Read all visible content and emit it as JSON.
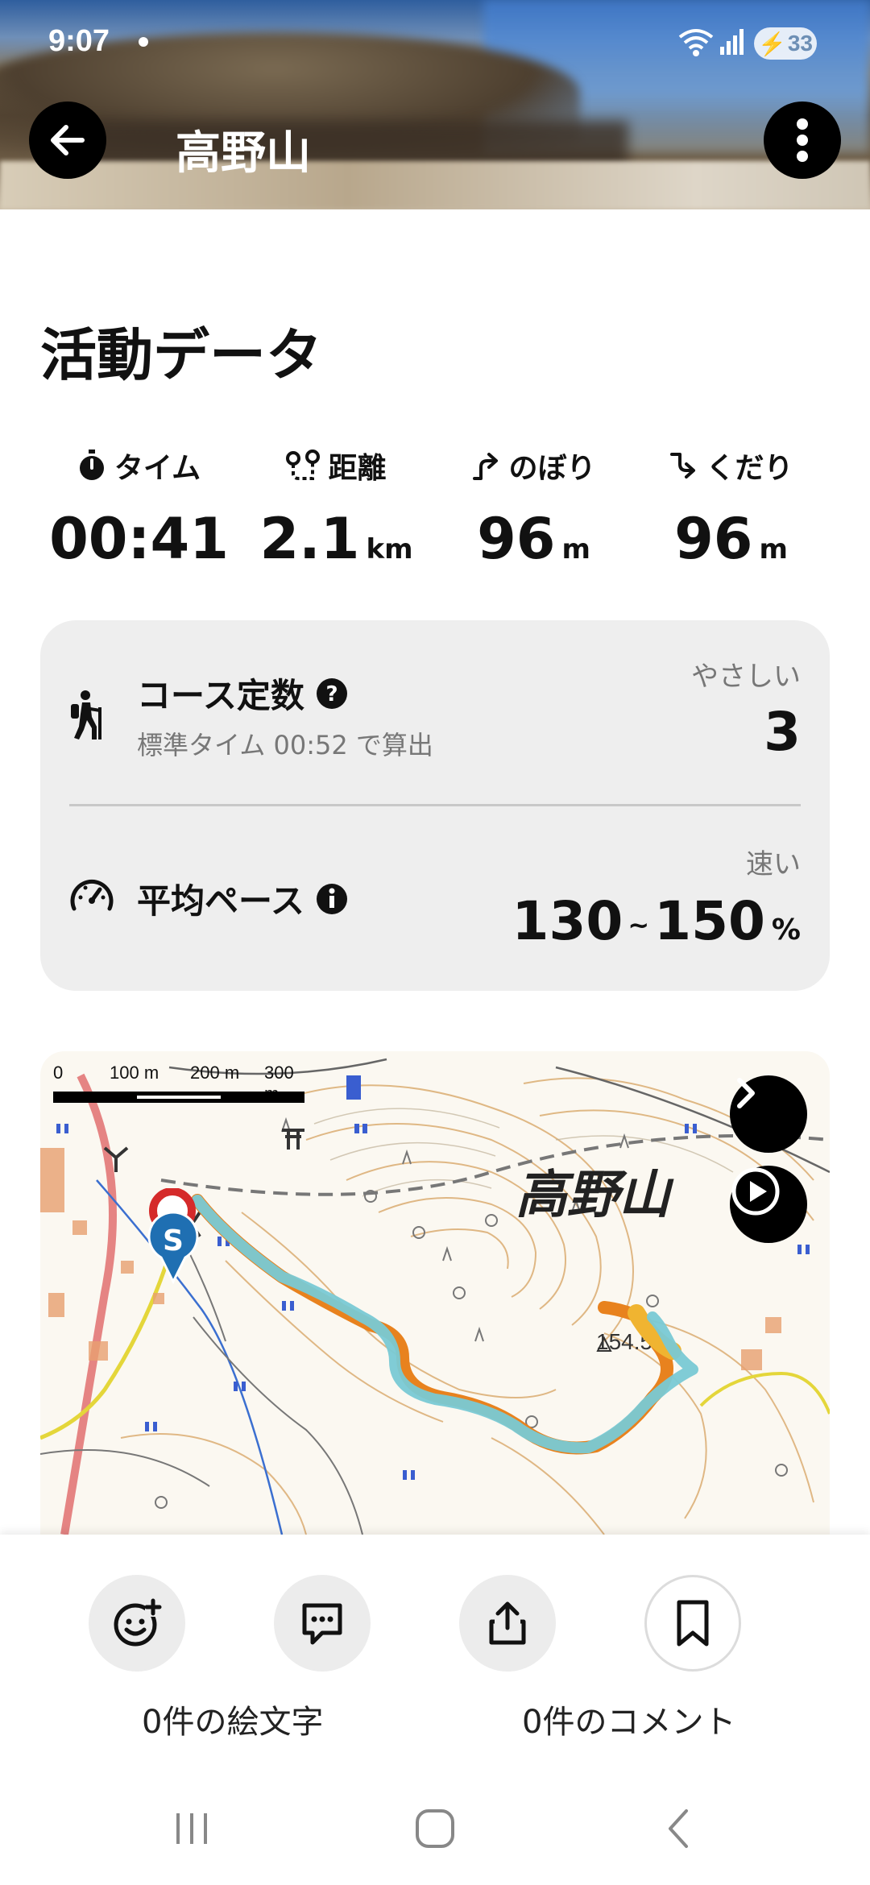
{
  "status": {
    "time": "9:07",
    "battery": "33"
  },
  "header": {
    "title": "高野山"
  },
  "section": {
    "title": "活動データ"
  },
  "stats": [
    {
      "icon": "stopwatch-icon",
      "label": "タイム",
      "value": "00:41",
      "unit": ""
    },
    {
      "icon": "route-icon",
      "label": "距離",
      "value": "2.1",
      "unit": "km"
    },
    {
      "icon": "ascent-icon",
      "label": "のぼり",
      "value": "96",
      "unit": "m"
    },
    {
      "icon": "descent-icon",
      "label": "くだり",
      "value": "96",
      "unit": "m"
    }
  ],
  "course": {
    "label": "コース定数",
    "sub": "標準タイム 00:52 で算出",
    "rating": "やさしい",
    "value": "3"
  },
  "pace": {
    "label": "平均ペース",
    "rating": "速い",
    "from": "130",
    "tilde": "~",
    "to": "150",
    "unit": "%"
  },
  "map": {
    "scale": [
      "0",
      "100 m",
      "200 m",
      "300 m"
    ],
    "place_name": "高野山",
    "elevation": "154.5",
    "start_marker": "S"
  },
  "actions": {
    "emoji_caption": "0件の絵文字",
    "comment_caption": "0件のコメント"
  },
  "colors": {
    "accent": "#000000",
    "track_main": "#79c9d4",
    "track_alt": "#e8821e",
    "start": "#1f6fb2",
    "goal": "#d52a2a"
  }
}
